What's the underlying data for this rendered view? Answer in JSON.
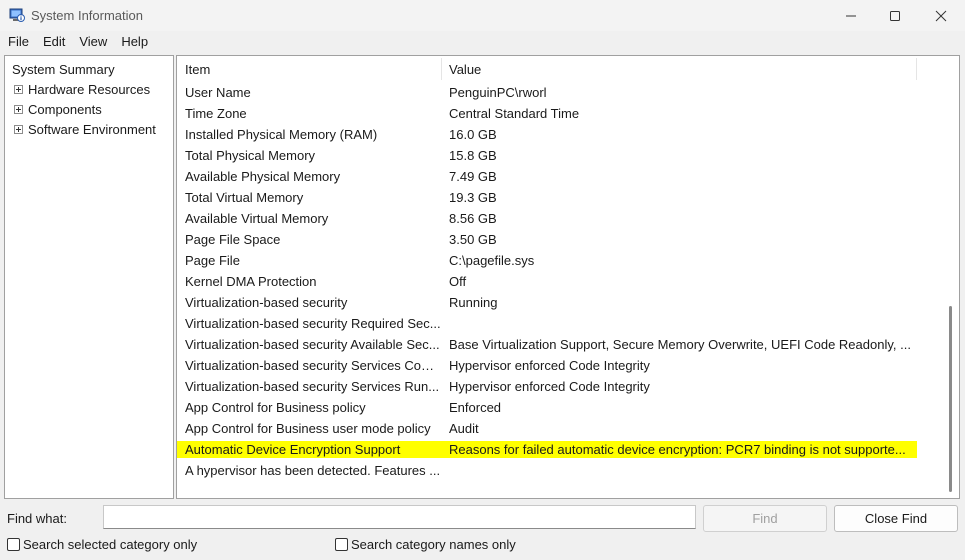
{
  "window": {
    "title": "System Information",
    "controls": {
      "minimize": "—",
      "maximize": "☐",
      "close": "✕"
    }
  },
  "menu": [
    "File",
    "Edit",
    "View",
    "Help"
  ],
  "tree": {
    "root": "System Summary",
    "children": [
      "Hardware Resources",
      "Components",
      "Software Environment"
    ]
  },
  "list": {
    "headers": {
      "item": "Item",
      "value": "Value"
    },
    "rows": [
      {
        "item": "User Name",
        "value": "PenguinPC\\rworl"
      },
      {
        "item": "Time Zone",
        "value": "Central Standard Time"
      },
      {
        "item": "Installed Physical Memory (RAM)",
        "value": "16.0 GB"
      },
      {
        "item": "Total Physical Memory",
        "value": "15.8 GB"
      },
      {
        "item": "Available Physical Memory",
        "value": "7.49 GB"
      },
      {
        "item": "Total Virtual Memory",
        "value": "19.3 GB"
      },
      {
        "item": "Available Virtual Memory",
        "value": "8.56 GB"
      },
      {
        "item": "Page File Space",
        "value": "3.50 GB"
      },
      {
        "item": "Page File",
        "value": "C:\\pagefile.sys"
      },
      {
        "item": "Kernel DMA Protection",
        "value": "Off"
      },
      {
        "item": "Virtualization-based security",
        "value": "Running"
      },
      {
        "item": "Virtualization-based security Required Sec...",
        "value": ""
      },
      {
        "item": "Virtualization-based security Available Sec...",
        "value": "Base Virtualization Support, Secure Memory Overwrite, UEFI Code Readonly, ..."
      },
      {
        "item": "Virtualization-based security Services Conf...",
        "value": "Hypervisor enforced Code Integrity"
      },
      {
        "item": "Virtualization-based security Services Run...",
        "value": "Hypervisor enforced Code Integrity"
      },
      {
        "item": "App Control for Business policy",
        "value": "Enforced"
      },
      {
        "item": "App Control for Business user mode policy",
        "value": "Audit"
      },
      {
        "item": "Automatic Device Encryption Support",
        "value": "Reasons for failed automatic device encryption: PCR7 binding is not supporte...",
        "highlight": true
      },
      {
        "item": "A hypervisor has been detected. Features ...",
        "value": ""
      }
    ]
  },
  "find": {
    "label": "Find what:",
    "value": "",
    "find_button": "Find",
    "close_button": "Close Find",
    "search_selected": "Search selected category only",
    "search_names": "Search category names only"
  },
  "colors": {
    "highlight": "#ffff00",
    "background": "#f0f0f0"
  }
}
